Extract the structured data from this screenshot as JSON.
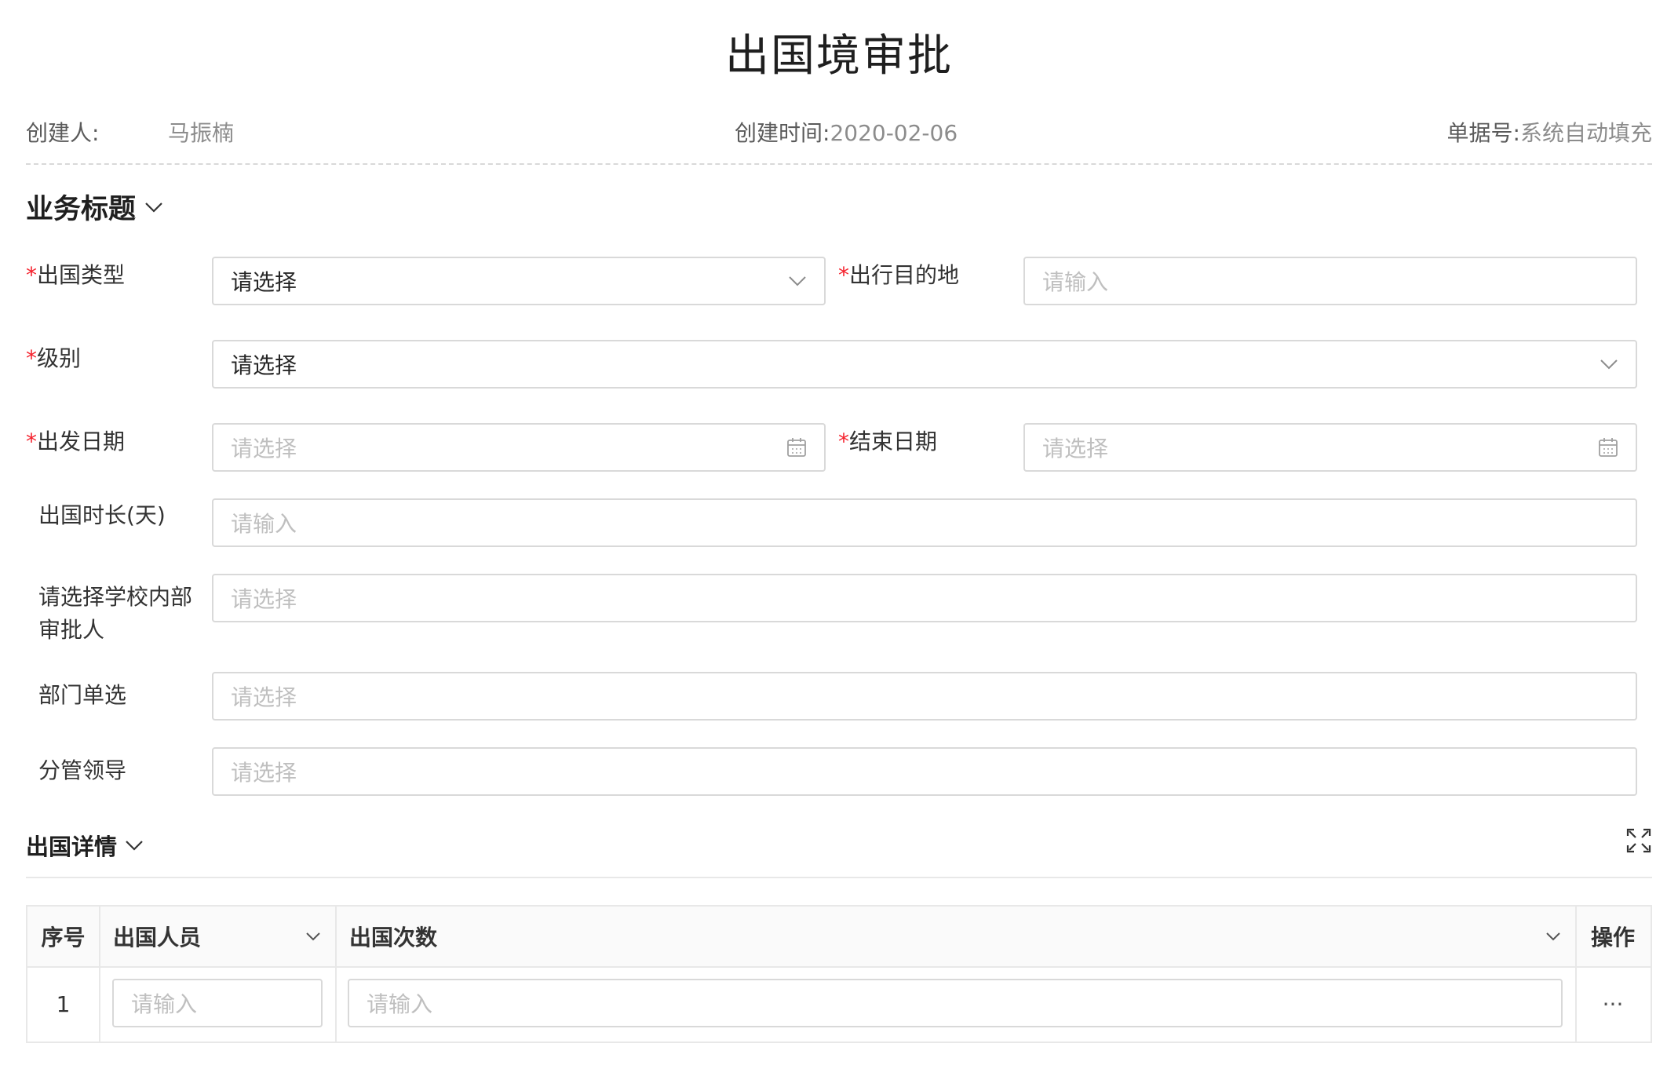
{
  "page": {
    "title": "出国境审批"
  },
  "meta": {
    "creator_label": "创建人:",
    "creator_value": "马振楠",
    "created_time_label": "创建时间:",
    "created_time_value": "2020-02-06",
    "doc_no_label": "单据号:",
    "doc_no_value": "系统自动填充"
  },
  "section_business": {
    "title": "业务标题",
    "icon": "chevron-down-icon"
  },
  "form": {
    "required_mark": "*",
    "trip_type": {
      "label": "出国类型",
      "value": "请选择",
      "icon": "chevron-down-icon"
    },
    "destination": {
      "label": "出行目的地",
      "placeholder": "请输入"
    },
    "level": {
      "label": "级别",
      "value": "请选择",
      "icon": "chevron-down-icon"
    },
    "start_date": {
      "label": "出发日期",
      "placeholder": "请选择",
      "icon": "calendar-icon"
    },
    "end_date": {
      "label": "结束日期",
      "placeholder": "请选择",
      "icon": "calendar-icon"
    },
    "duration": {
      "label": "出国时长(天)",
      "placeholder": "请输入"
    },
    "approver": {
      "label_line1": "请选择学校内部",
      "label_line2": "审批人",
      "placeholder": "请选择"
    },
    "department": {
      "label": "部门单选",
      "placeholder": "请选择"
    },
    "leader": {
      "label": "分管领导",
      "placeholder": "请选择"
    }
  },
  "section_details": {
    "title": "出国详情",
    "icon": "chevron-down-icon",
    "expand_icon": "expand-icon"
  },
  "table": {
    "headers": [
      "序号",
      "出国人员",
      "出国次数",
      "操作"
    ],
    "rows": [
      {
        "index": "1",
        "person_placeholder": "请输入",
        "count_placeholder": "请输入",
        "action": "···"
      }
    ]
  },
  "colors": {
    "required": "#f5222d",
    "border": "#d9d9d9",
    "placeholder": "#bfbfbf"
  }
}
